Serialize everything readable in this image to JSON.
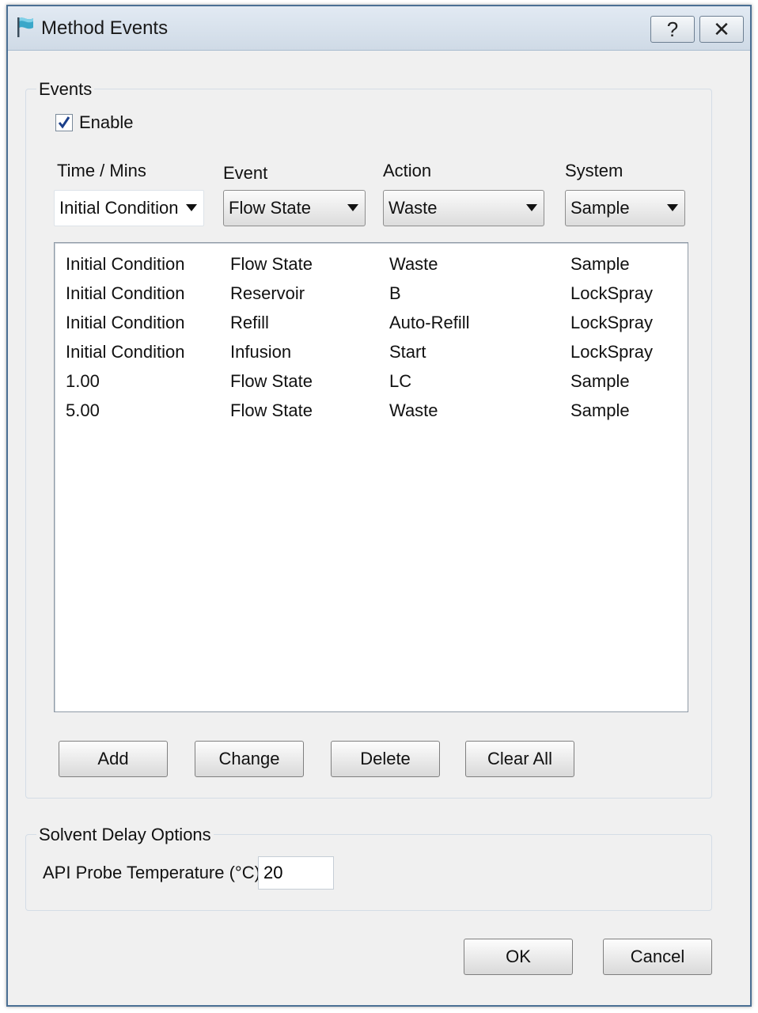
{
  "window": {
    "title": "Method Events",
    "help_glyph": "?",
    "close_glyph": "✕",
    "accent": "#4a6f94",
    "icon": "flag-icon"
  },
  "events": {
    "legend": "Events",
    "enable_label": "Enable",
    "enable_checked": true,
    "columns": {
      "time": "Time / Mins",
      "event": "Event",
      "action": "Action",
      "system": "System"
    },
    "selectors": {
      "time": "Initial Condition",
      "event": "Flow State",
      "action": "Waste",
      "system": "Sample"
    },
    "rows": [
      {
        "time": "Initial Condition",
        "event": "Flow State",
        "action": "Waste",
        "system": "Sample"
      },
      {
        "time": "Initial Condition",
        "event": "Reservoir",
        "action": "B",
        "system": "LockSpray"
      },
      {
        "time": "Initial Condition",
        "event": "Refill",
        "action": "Auto-Refill",
        "system": "LockSpray"
      },
      {
        "time": "Initial Condition",
        "event": "Infusion",
        "action": "Start",
        "system": "LockSpray"
      },
      {
        "time": "1.00",
        "event": "Flow State",
        "action": "LC",
        "system": "Sample"
      },
      {
        "time": "5.00",
        "event": "Flow State",
        "action": "Waste",
        "system": "Sample"
      }
    ],
    "buttons": {
      "add": "Add",
      "change": "Change",
      "delete": "Delete",
      "clear_all": "Clear All"
    }
  },
  "solvent": {
    "legend": "Solvent Delay Options",
    "probe_label": "API Probe Temperature (°C):",
    "probe_value": "20"
  },
  "dialog": {
    "ok": "OK",
    "cancel": "Cancel"
  }
}
